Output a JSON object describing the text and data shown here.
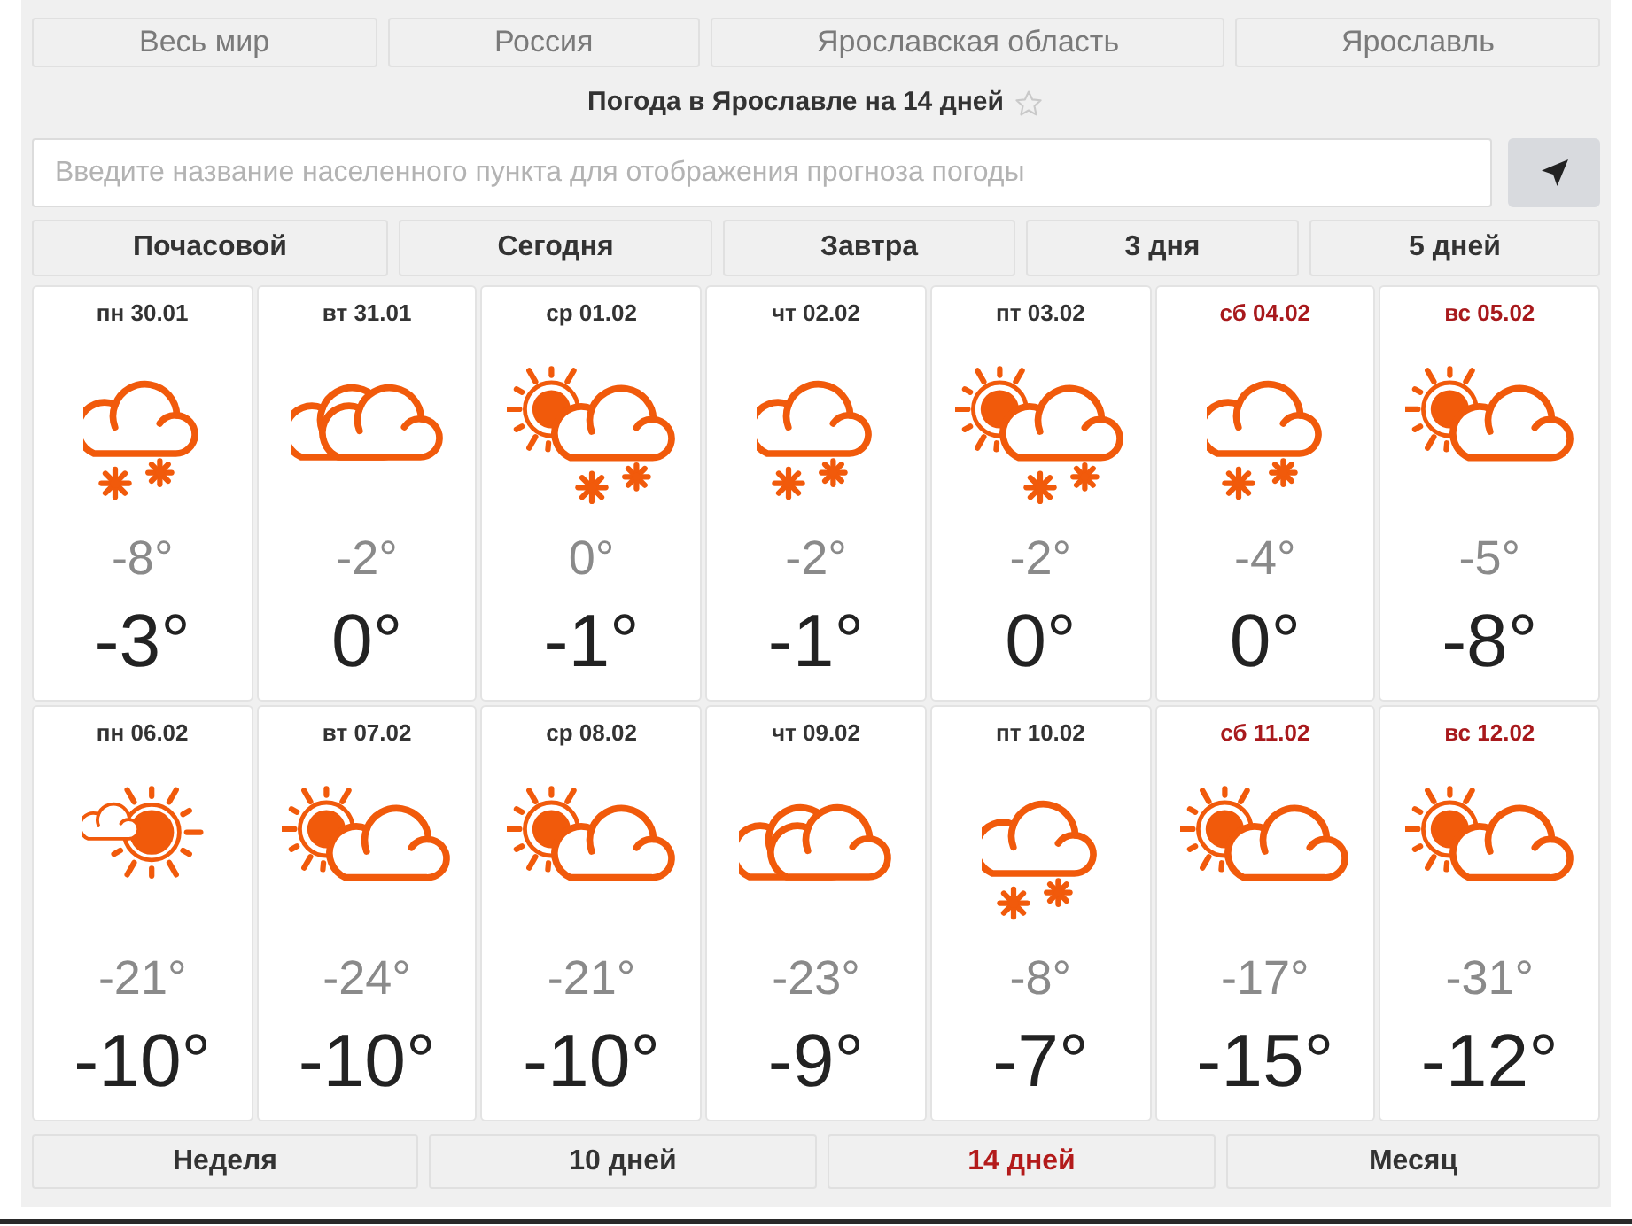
{
  "breadcrumbs": [
    "Весь мир",
    "Россия",
    "Ярославская область",
    "Ярославль"
  ],
  "title": {
    "text": "Погода в Ярославле на 14 дней",
    "favorite": false
  },
  "search": {
    "placeholder": "Введите название населенного пункта для отображения прогноза погоды"
  },
  "period_tabs": [
    {
      "label": "Почасовой",
      "selected": false
    },
    {
      "label": "Сегодня",
      "selected": false
    },
    {
      "label": "Завтра",
      "selected": false
    },
    {
      "label": "3 дня",
      "selected": false
    },
    {
      "label": "5 дней",
      "selected": false
    }
  ],
  "days": [
    {
      "date": "пн 30.01",
      "weekend": false,
      "kind": "snow",
      "small_temp": "-8°",
      "large_temp": "-3°"
    },
    {
      "date": "вт 31.01",
      "weekend": false,
      "kind": "overcast",
      "small_temp": "-2°",
      "large_temp": "0°"
    },
    {
      "date": "ср 01.02",
      "weekend": false,
      "kind": "partly_cloudy_snow",
      "small_temp": "0°",
      "large_temp": "-1°"
    },
    {
      "date": "чт 02.02",
      "weekend": false,
      "kind": "snow",
      "small_temp": "-2°",
      "large_temp": "-1°"
    },
    {
      "date": "пт 03.02",
      "weekend": false,
      "kind": "partly_cloudy_snow",
      "small_temp": "-2°",
      "large_temp": "0°"
    },
    {
      "date": "сб 04.02",
      "weekend": true,
      "kind": "snow",
      "small_temp": "-4°",
      "large_temp": "0°"
    },
    {
      "date": "вс 05.02",
      "weekend": true,
      "kind": "partly_cloudy",
      "small_temp": "-5°",
      "large_temp": "-8°"
    },
    {
      "date": "пн 06.02",
      "weekend": false,
      "kind": "mostly_sunny",
      "small_temp": "-21°",
      "large_temp": "-10°"
    },
    {
      "date": "вт 07.02",
      "weekend": false,
      "kind": "partly_cloudy",
      "small_temp": "-24°",
      "large_temp": "-10°"
    },
    {
      "date": "ср 08.02",
      "weekend": false,
      "kind": "partly_cloudy",
      "small_temp": "-21°",
      "large_temp": "-10°"
    },
    {
      "date": "чт 09.02",
      "weekend": false,
      "kind": "overcast",
      "small_temp": "-23°",
      "large_temp": "-9°"
    },
    {
      "date": "пт 10.02",
      "weekend": false,
      "kind": "snow",
      "small_temp": "-8°",
      "large_temp": "-7°"
    },
    {
      "date": "сб 11.02",
      "weekend": true,
      "kind": "partly_cloudy",
      "small_temp": "-17°",
      "large_temp": "-15°"
    },
    {
      "date": "вс 12.02",
      "weekend": true,
      "kind": "partly_cloudy",
      "small_temp": "-31°",
      "large_temp": "-12°"
    }
  ],
  "range_tabs": [
    {
      "label": "Неделя",
      "selected": false
    },
    {
      "label": "10 дней",
      "selected": false
    },
    {
      "label": "14 дней",
      "selected": true
    },
    {
      "label": "Месяц",
      "selected": false
    }
  ]
}
